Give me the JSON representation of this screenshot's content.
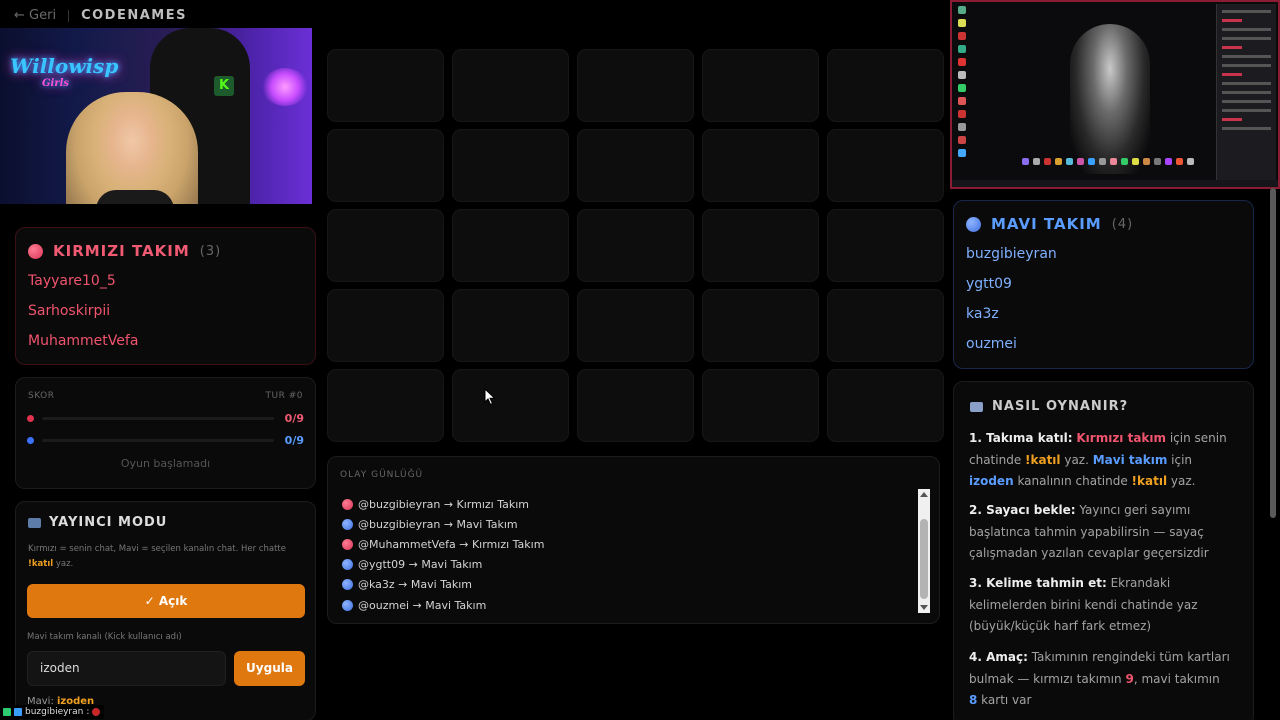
{
  "topbar": {
    "back_label": "← Geri",
    "brand": "CODENAMES"
  },
  "webcam": {
    "neon_text": "Willowisp",
    "neon_sub": "Girls",
    "kick_letter": "K"
  },
  "red_team": {
    "title": "KIRMIZI TAKIM",
    "count": "(3)",
    "members": [
      "Tayyare10_5",
      "Sarhoskirpii",
      "MuhammetVefa"
    ]
  },
  "blue_team": {
    "title": "MAVI TAKIM",
    "count": "(4)",
    "members": [
      "buzgibieyran",
      "ygtt09",
      "ka3z",
      "ouzmei"
    ]
  },
  "score": {
    "label": "SKOR",
    "turn": "TUR #0",
    "red_value": "0/9",
    "blue_value": "0/9",
    "red_progress": 0,
    "blue_progress": 0,
    "state": "Oyun başlamadı"
  },
  "streamer": {
    "title": "YAYINCI MODU",
    "desc_pre": "Kırmızı = senin chat, Mavi = seçilen kanalın chat. Her chatte ",
    "desc_cmd": "!katıl",
    "desc_post": " yaz.",
    "toggle_label": "✓ Açık",
    "channel_label": "Mavi takım kanalı (Kick kullanıcı adı)",
    "channel_value": "izoden",
    "apply_label": "Uygula",
    "current_prefix": "Mavi: ",
    "current_value": "izoden"
  },
  "chat": {
    "user": "buzgibieyran",
    "sep": ":"
  },
  "grid": {
    "rows": 5,
    "cols": 5
  },
  "log": {
    "title": "OLAY GÜNLÜĞÜ",
    "entries": [
      {
        "team": "red",
        "text": "@buzgibieyran → Kırmızı Takım"
      },
      {
        "team": "blue",
        "text": "@buzgibieyran → Mavi Takım"
      },
      {
        "team": "red",
        "text": "@MuhammetVefa → Kırmızı Takım"
      },
      {
        "team": "blue",
        "text": "@ygtt09 → Mavi Takım"
      },
      {
        "team": "blue",
        "text": "@ka3z → Mavi Takım"
      },
      {
        "team": "blue",
        "text": "@ouzmei → Mavi Takım"
      }
    ]
  },
  "howto": {
    "title": "NASIL OYNANIR?",
    "s1_head": "1. Takıma katıl:",
    "s1_red": "Kırmızı takım",
    "s1_a": " için senin chatinde ",
    "s1_cmd1": "!katıl",
    "s1_b": " yaz. ",
    "s1_blue": "Mavi takım",
    "s1_c": " için ",
    "s1_chan": "izoden",
    "s1_d": " kanalının chatinde ",
    "s1_cmd2": "!katıl",
    "s1_e": " yaz.",
    "s2_head": "2. Sayacı bekle:",
    "s2_text": " Yayıncı geri sayımı başlatınca tahmin yapabilirsin — sayaç çalışmadan yazılan cevaplar geçersizdir",
    "s3_head": "3. Kelime tahmin et:",
    "s3_text": " Ekrandaki kelimelerden birini kendi chatinde yaz (büyük/küçük harf fark etmez)",
    "s4_head": "4. Amaç:",
    "s4_a": " Takımının rengindeki tüm kartları bulmak — kırmızı takımın ",
    "s4_red": "9",
    "s4_b": ", mavi takımın ",
    "s4_blue": "8",
    "s4_c": " kartı var"
  },
  "colors": {
    "red": "#f0546e",
    "blue": "#5a9cff",
    "accent": "#e07810",
    "cmd": "#f0a020"
  }
}
